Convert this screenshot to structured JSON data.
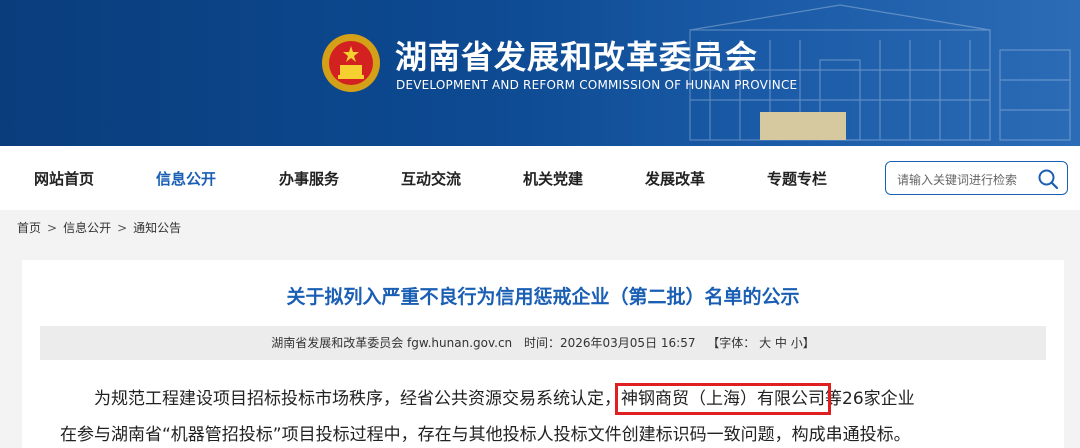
{
  "header": {
    "title": "湖南省发展和改革委员会",
    "subtitle": "DEVELOPMENT AND REFORM COMMISSION OF HUNAN PROVINCE",
    "emblem_icon": "national-emblem-icon",
    "brand_color": "#0d4a92"
  },
  "nav": {
    "items": [
      {
        "label": "网站首页",
        "active": false
      },
      {
        "label": "信息公开",
        "active": true
      },
      {
        "label": "办事服务",
        "active": false
      },
      {
        "label": "互动交流",
        "active": false
      },
      {
        "label": "机关党建",
        "active": false
      },
      {
        "label": "发展改革",
        "active": false
      },
      {
        "label": "专题专栏",
        "active": false
      }
    ],
    "active_color": "#1a5fb4"
  },
  "search": {
    "placeholder": "请输入关键词进行检索",
    "icon": "search-icon"
  },
  "breadcrumb": {
    "items": [
      "首页",
      "信息公开",
      "通知公告"
    ],
    "separator": ">"
  },
  "article": {
    "title": "关于拟列入严重不良行为信用惩戒企业（第二批）名单的公示",
    "meta": {
      "source": "湖南省发展和改革委员会 fgw.hunan.gov.cn",
      "time": "时间：2026年03月05日 16:57",
      "font_size": "【字体： 大 中 小】"
    },
    "body": {
      "line1_before": "为规范工程建设项目招标投标市场秩序，经省公共资源交易系统认定，",
      "line1_highlight": "神钢商贸（上海）有限公司",
      "line1_after": "等26家企业",
      "line2": "在参与湖南省“机器管招投标”项目投标过程中，存在与其他投标人投标文件创建标识码一致问题，构成串通投标。"
    },
    "highlight_color": "#e02020"
  }
}
